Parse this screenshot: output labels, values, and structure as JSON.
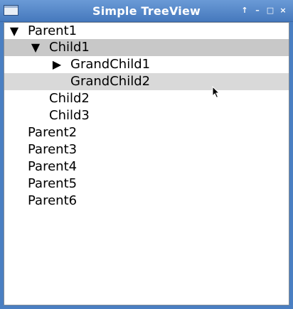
{
  "window": {
    "title": "Simple TreeView",
    "controls": {
      "up": "↑",
      "minimize": "–",
      "maximize": "□",
      "close": "×"
    }
  },
  "tree": {
    "arrows": {
      "expanded": "▼",
      "collapsed": "▶"
    },
    "rows": [
      {
        "label": "Parent1",
        "state": "expanded"
      },
      {
        "label": "Child1",
        "state": "expanded"
      },
      {
        "label": "GrandChild1",
        "state": "collapsed"
      },
      {
        "label": "GrandChild2",
        "state": "leaf"
      },
      {
        "label": "Child2",
        "state": "leaf"
      },
      {
        "label": "Child3",
        "state": "leaf"
      },
      {
        "label": "Parent2",
        "state": "leaf"
      },
      {
        "label": "Parent3",
        "state": "leaf"
      },
      {
        "label": "Parent4",
        "state": "leaf"
      },
      {
        "label": "Parent5",
        "state": "leaf"
      },
      {
        "label": "Parent6",
        "state": "leaf"
      }
    ]
  },
  "colors": {
    "titlebar": "#4a7fc2",
    "selected_row": "#c8c8c8",
    "hovered_row": "#d9d9d9"
  }
}
